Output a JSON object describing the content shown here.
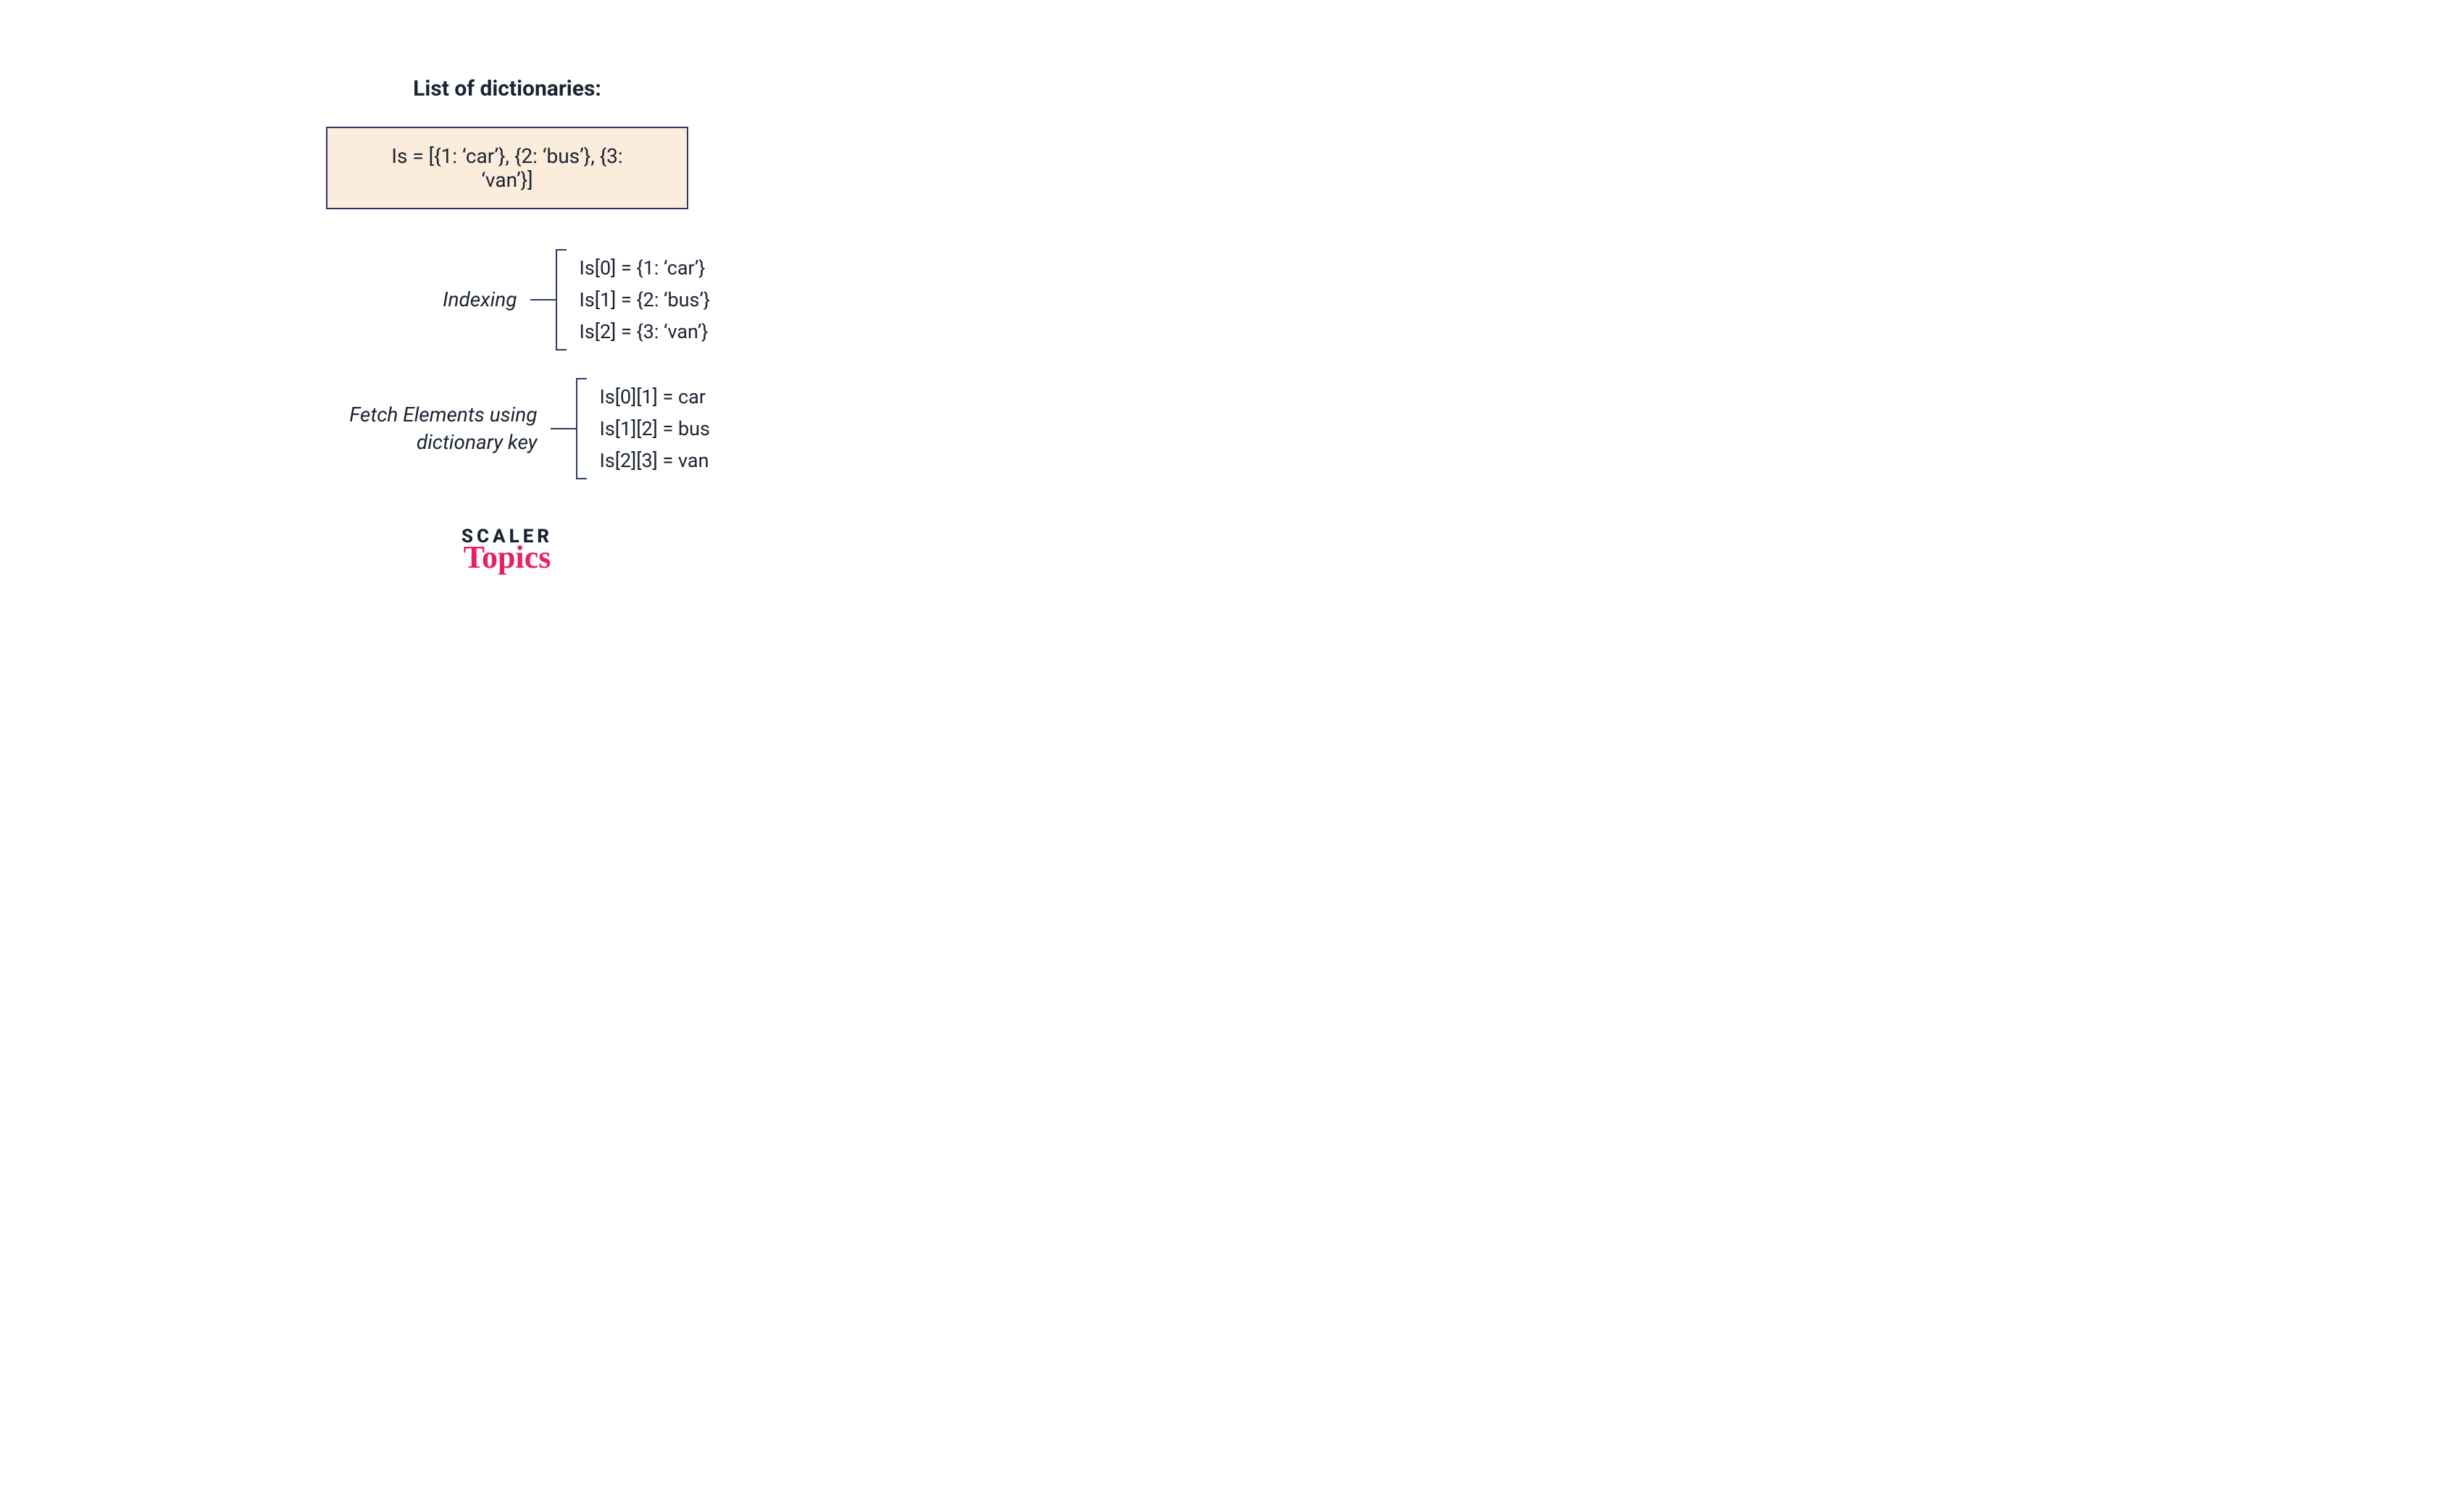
{
  "title": "List of dictionaries:",
  "code": "Is = [{1: ‘car’}, {2: ‘bus’}, {3: ‘van’}]",
  "sections": [
    {
      "label": "Indexing",
      "items": [
        "Is[0] = {1: ‘car’}",
        "Is[1] = {2: ‘bus’}",
        "Is[2] = {3: ‘van’}"
      ]
    },
    {
      "label": "Fetch Elements using dictionary key",
      "items": [
        "Is[0][1] = car",
        "Is[1][2] = bus",
        "Is[2][3] = van"
      ]
    }
  ],
  "logo": {
    "top": "SCALER",
    "bottom": "Topics"
  },
  "colors": {
    "navy": "#1a2332",
    "border": "#2f3a63",
    "boxbg": "#fbecdb",
    "pink": "#e91e63"
  }
}
